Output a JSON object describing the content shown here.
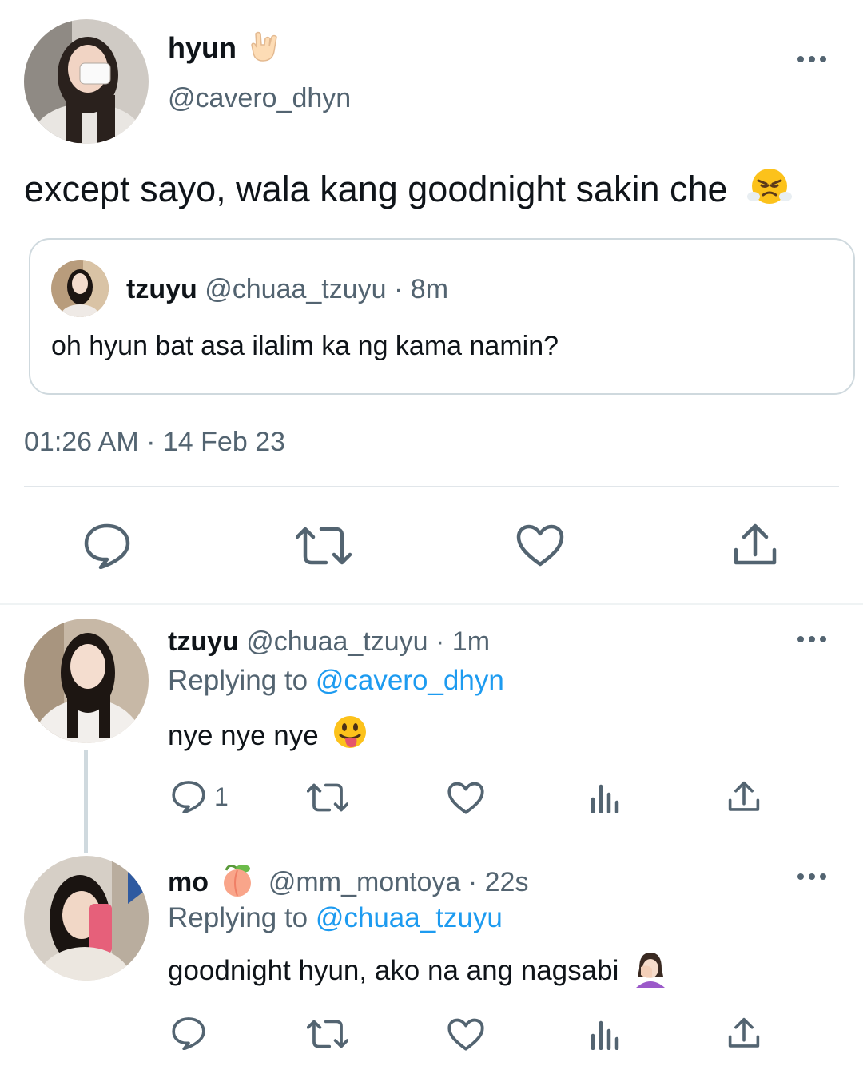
{
  "main_tweet": {
    "author_name": "hyun",
    "author_handle": "@cavero_dhyn",
    "text": "except sayo, wala kang goodnight sakin che",
    "timestamp": "01:26 AM",
    "date": "14 Feb 23",
    "quoted": {
      "author_name": "tzuyu",
      "author_handle": "@chuaa_tzuyu",
      "time": "8m",
      "text": "oh hyun bat asa ilalim ka ng kama namin?"
    }
  },
  "replies": [
    {
      "author_name": "tzuyu",
      "author_handle": "@chuaa_tzuyu",
      "time": "1m",
      "replying_prefix": "Replying to",
      "replying_to": "@cavero_dhyn",
      "text": "nye nye nye",
      "reply_count": "1"
    },
    {
      "author_name": "mo",
      "author_handle": "@mm_montoya",
      "time": "22s",
      "replying_prefix": "Replying to",
      "replying_to": "@chuaa_tzuyu",
      "text": "goodnight hyun, ako na ang nagsabi"
    }
  ],
  "separator": "·",
  "icons": [
    "more-icon",
    "reply-icon",
    "retweet-icon",
    "like-icon",
    "share-icon",
    "views-icon"
  ],
  "colors": {
    "link": "#1d9bf0",
    "muted": "#536471",
    "text": "#0f1419",
    "border": "#cfd9de"
  }
}
